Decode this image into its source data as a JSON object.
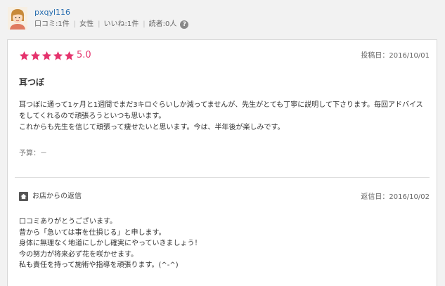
{
  "user": {
    "name": "pxqyl116",
    "stats": [
      "口コミ:1件",
      "女性",
      "いいね:1件",
      "読者:0人"
    ],
    "help_icon": "question-circle-icon"
  },
  "review": {
    "rating": 5,
    "rating_text": "5.0",
    "star_color": "#e5336d",
    "post_date": "投稿日：2016/10/01",
    "title": "耳つぼ",
    "body_lines": [
      "耳つぼに通って1ヶ月と1週間でまだ3キロぐらいしか減ってませんが、先生がとても丁寧に説明して下さります。毎回アドバイスをしてくれるので頑張ろうといつも思います。",
      "これからも先生を信じて頑張って痩せたいと思います。今は、半年後が楽しみです。"
    ],
    "budget": "予算：－"
  },
  "reply": {
    "icon": "home-icon",
    "label": "お店からの返信",
    "date": "返信日：2016/10/02",
    "lines": [
      "口コミありがとうございます。",
      "昔から「急いては事を仕損じる」と申します。",
      "身体に無理なく地道にしかし確実にやっていきましょう！",
      "今の努力が将来必ず花を咲かせます。",
      "私も責任を持って施術や指導を頑張ります。(^-^)"
    ]
  }
}
